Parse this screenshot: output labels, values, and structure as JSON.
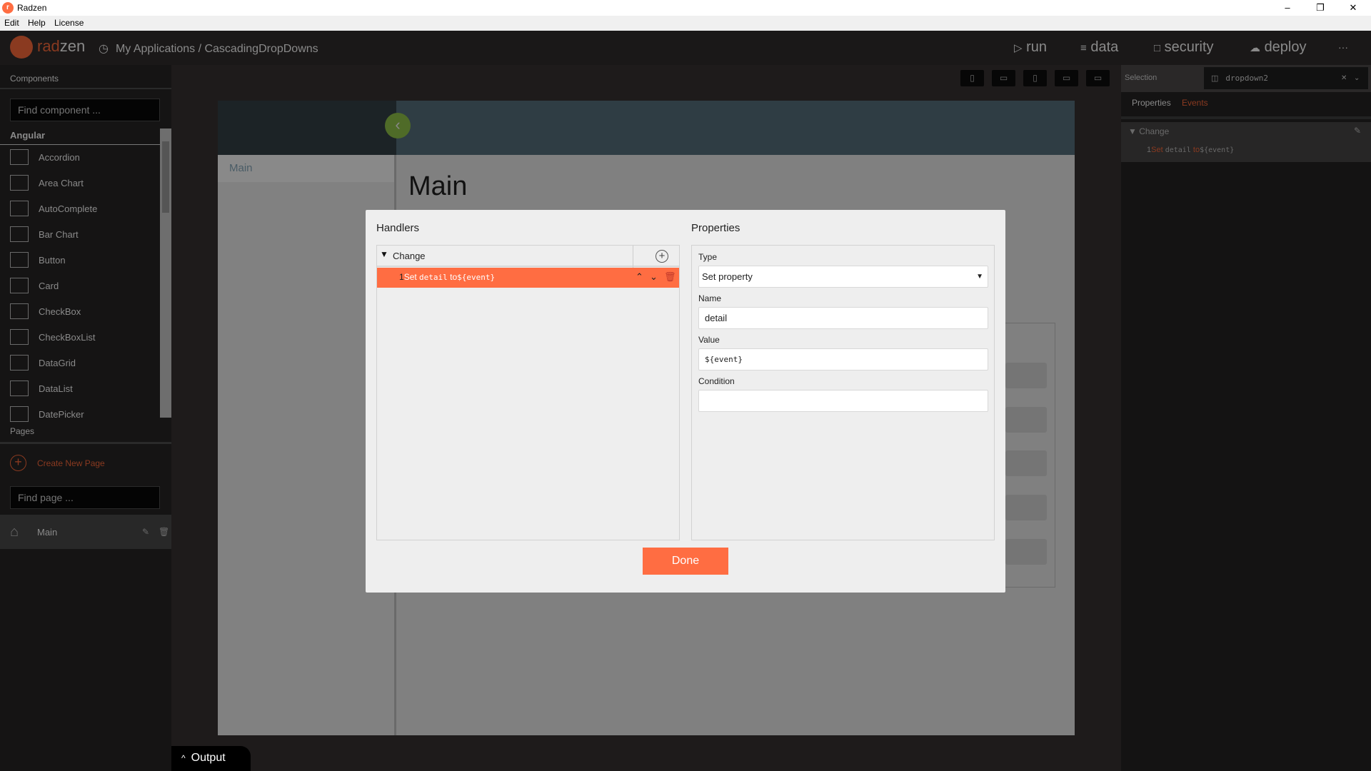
{
  "window": {
    "title": "Radzen",
    "menu": [
      "Edit",
      "Help",
      "License"
    ]
  },
  "header": {
    "brand_a": "rad",
    "brand_b": "zen",
    "breadcrumb": "My Applications / CascadingDropDowns",
    "nav": [
      {
        "icon": "play-icon",
        "label": "run"
      },
      {
        "icon": "layers-icon",
        "label": "data"
      },
      {
        "icon": "lock-icon",
        "label": "security"
      },
      {
        "icon": "cloud-upload-icon",
        "label": "deploy"
      }
    ],
    "more": "···"
  },
  "sidebar": {
    "components_title": "Components",
    "search_placeholder": "Find component ...",
    "group": "Angular",
    "components": [
      "Accordion",
      "Area Chart",
      "AutoComplete",
      "Bar Chart",
      "Button",
      "Card",
      "CheckBox",
      "CheckBoxList",
      "DataGrid",
      "DataList",
      "DatePicker"
    ],
    "pages_title": "Pages",
    "create_page": "Create New Page",
    "page_search_placeholder": "Find page ...",
    "pages": [
      "Main"
    ]
  },
  "canvas": {
    "nav_item": "Main",
    "page_title": "Main"
  },
  "right_panel": {
    "selection_label": "Selection",
    "selection_value": "dropdown2",
    "tabs": [
      "Properties",
      "Events"
    ],
    "event": "Change",
    "action": {
      "index": "1",
      "verb": "Set",
      "name": "detail",
      "to": "to",
      "value": "${event}"
    }
  },
  "dialog": {
    "handlers_title": "Handlers",
    "properties_title": "Properties",
    "event": "Change",
    "action": {
      "index": "1",
      "verb": "Set",
      "name": "detail",
      "to": "to",
      "value": "${event}"
    },
    "type_label": "Type",
    "type_value": "Set property",
    "name_label": "Name",
    "name_value": "detail",
    "value_label": "Value",
    "value_value": "${event}",
    "condition_label": "Condition",
    "condition_value": "",
    "done": "Done"
  },
  "output": {
    "label": "Output"
  },
  "colors": {
    "accent": "#ff6d42"
  }
}
